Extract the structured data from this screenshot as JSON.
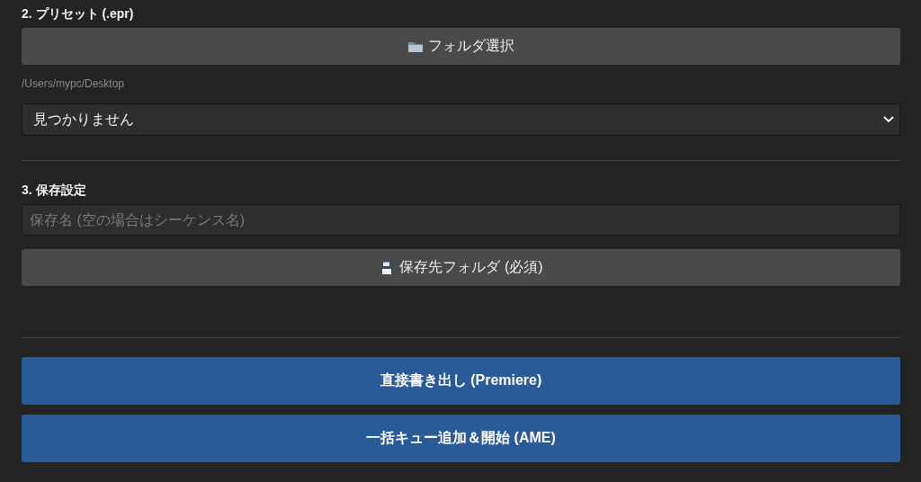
{
  "preset_section": {
    "heading": "2. プリセット (.epr)",
    "folder_button": {
      "label": "フォルダ選択",
      "kind": "folder"
    },
    "path": "/Users/mypc/Desktop",
    "select": {
      "value": "見つかりません"
    }
  },
  "save_section": {
    "heading": "3. 保存設定",
    "name_field": {
      "placeholder": "保存名 (空の場合はシーケンス名)"
    },
    "folder_button": {
      "label": "保存先フォルダ (必須)",
      "kind": "floppy"
    }
  },
  "actions": [
    {
      "label": "直接書き出し (Premiere)"
    },
    {
      "label": "一括キュー追加＆開始 (AME)"
    }
  ]
}
